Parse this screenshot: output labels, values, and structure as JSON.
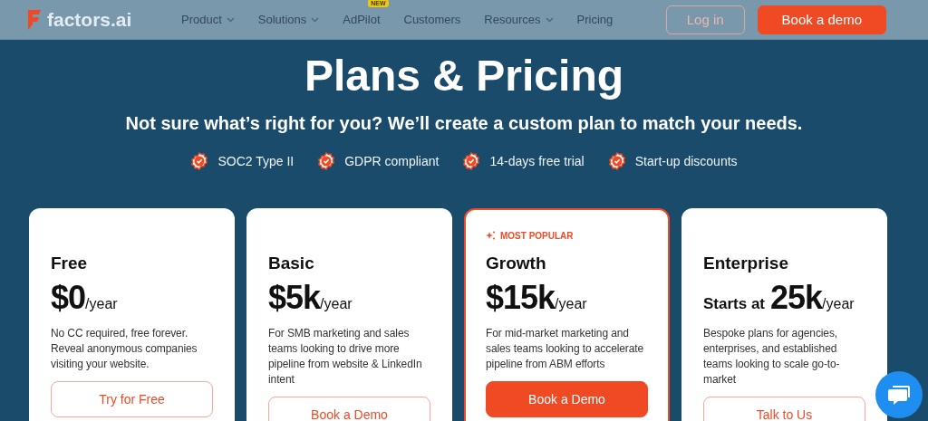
{
  "header": {
    "logo": "factors.ai",
    "nav": [
      {
        "label": "Product",
        "dropdown": true
      },
      {
        "label": "Solutions",
        "dropdown": true
      },
      {
        "label": "AdPilot",
        "dropdown": false,
        "badge": "NEW"
      },
      {
        "label": "Customers",
        "dropdown": false
      },
      {
        "label": "Resources",
        "dropdown": true
      },
      {
        "label": "Pricing",
        "dropdown": false
      }
    ],
    "buttons": [
      {
        "label": "Log in",
        "kind": "outline"
      },
      {
        "label": "Book a demo",
        "kind": "filled"
      }
    ]
  },
  "hero": {
    "title": "Plans & Pricing",
    "subtitle": "Not sure what’s right for you? We’ll create a custom plan to match your needs.",
    "highlights": [
      "SOC2 Type II",
      "GDPR compliant",
      "14-days free trial",
      "Start-up discounts"
    ]
  },
  "plans": [
    {
      "name": "Free",
      "price": "$0",
      "period": "/year",
      "popular": false,
      "description": "No CC required, free forever. Reveal anonymous companies visiting your website.",
      "button": {
        "label": "Try for Free",
        "kind": "outline"
      }
    },
    {
      "name": "Basic",
      "price": "$5k",
      "period": "/year",
      "popular": false,
      "description": "For SMB marketing and sales teams looking to drive more pipeline from website & LinkedIn intent",
      "button": {
        "label": "Book a Demo",
        "kind": "outline"
      }
    },
    {
      "name": "Growth",
      "price": "$15k",
      "period": "/year",
      "popular": true,
      "tag": "MOST POPULAR",
      "description": "For mid-market marketing and sales teams looking to accelerate pipeline from ABM efforts",
      "button": {
        "label": "Book a Demo",
        "kind": "filled"
      }
    },
    {
      "name": "Enterprise",
      "prefix": "Starts at",
      "price": "25k",
      "period": "/year",
      "popular": false,
      "description": "Bespoke plans for agencies, enterprises, and established teams looking to scale go-to-market",
      "button": {
        "label": "Talk to Us",
        "kind": "outline"
      }
    }
  ]
}
